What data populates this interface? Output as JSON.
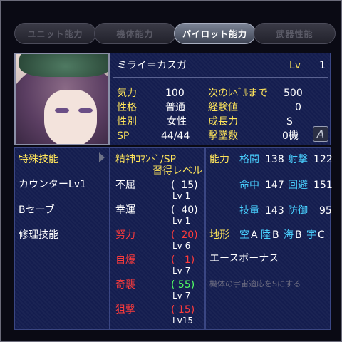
{
  "tabs": [
    {
      "label": "ユニット能力",
      "active": false
    },
    {
      "label": "機体能力",
      "active": false
    },
    {
      "label": "パイロット能力",
      "active": true
    },
    {
      "label": "武器性能",
      "active": false
    }
  ],
  "pilot": {
    "name": "ミライ＝カスガ",
    "lv_label": "Lv",
    "lv_value": "1"
  },
  "stats": {
    "kiryoku_label": "気力",
    "kiryoku_value": "100",
    "seikaku_label": "性格",
    "seikaku_value": "普通",
    "seibetsu_label": "性別",
    "seibetsu_value": "女性",
    "sp_label": "SP",
    "sp_value": "44/44",
    "next_label": "次のﾚﾍﾞﾙまで",
    "next_value": "500",
    "exp_label": "経験値",
    "exp_value": "0",
    "growth_label": "成長力",
    "growth_value": "S",
    "kills_label": "撃墜数",
    "kills_value": "0機",
    "emblem": "A"
  },
  "skills": {
    "header": "特殊技能",
    "items": [
      "カウンターLv1",
      "Bセーブ",
      "修理技能",
      "－－－－－－－－",
      "－－－－－－－－",
      "－－－－－－－－"
    ]
  },
  "spirit": {
    "header_line1": "精神ｺﾏﾝﾄﾞ/SP",
    "header_line2": "習得レベル",
    "items": [
      {
        "name": "不屈",
        "cost": "(  15)",
        "level": "Lv 1",
        "color": "#ffffff",
        "cost_color": "#ffffff"
      },
      {
        "name": "幸運",
        "cost": "(  40)",
        "level": "Lv 1",
        "color": "#ffffff",
        "cost_color": "#ffffff"
      },
      {
        "name": "努力",
        "cost": "(  20)",
        "level": "Lv 6",
        "color": "#ff3b3b",
        "cost_color": "#ff3b3b"
      },
      {
        "name": "自爆",
        "cost": "(   1)",
        "level": "Lv 7",
        "color": "#ff3b3b",
        "cost_color": "#ff3b3b"
      },
      {
        "name": "奇襲",
        "cost": "( 55)",
        "level": "Lv 7",
        "color": "#ff3b3b",
        "cost_color": "#51ff64"
      },
      {
        "name": "狙撃",
        "cost": "( 15)",
        "level": "Lv15",
        "color": "#ff3b3b",
        "cost_color": "#ff3b3b"
      }
    ]
  },
  "ability": {
    "header": "能力",
    "rows": [
      [
        {
          "label": "格闘",
          "value": "138"
        },
        {
          "label": "射撃",
          "value": "122"
        }
      ],
      [
        {
          "label": "命中",
          "value": "147"
        },
        {
          "label": "回避",
          "value": "151"
        }
      ],
      [
        {
          "label": "技量",
          "value": "143"
        },
        {
          "label": "防御",
          "value": "95"
        }
      ]
    ],
    "terrain_label": "地形",
    "terrain": [
      {
        "label": "空",
        "value": "A"
      },
      {
        "label": "陸",
        "value": "B"
      },
      {
        "label": "海",
        "value": "B"
      },
      {
        "label": "宇",
        "value": "C"
      }
    ],
    "ace_label": "エースボーナス",
    "ace_text": "機体の宇宙適応をSにする"
  }
}
